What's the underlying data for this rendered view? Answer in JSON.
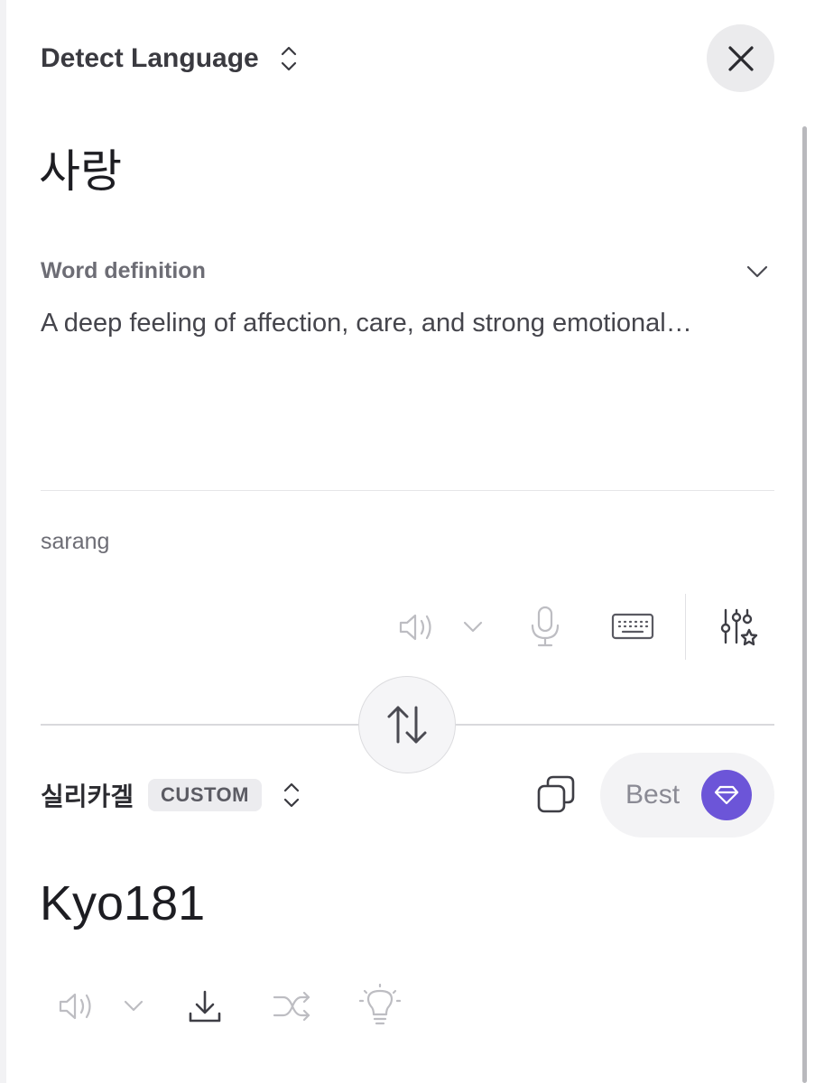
{
  "source": {
    "language_label": "Detect Language",
    "text": "사랑",
    "definition_label": "Word definition",
    "definition_text": "A deep feeling of affection, care, and strong emotional…",
    "romanization": "sarang"
  },
  "target": {
    "language_label": "실리카겔",
    "badge": "CUSTOM",
    "quality_label": "Best",
    "text": "Kyo181"
  },
  "icons": {
    "close": "close-icon",
    "swap": "swap-arrows-icon",
    "gem": "gem-icon"
  },
  "colors": {
    "accent": "#6c55d8"
  }
}
